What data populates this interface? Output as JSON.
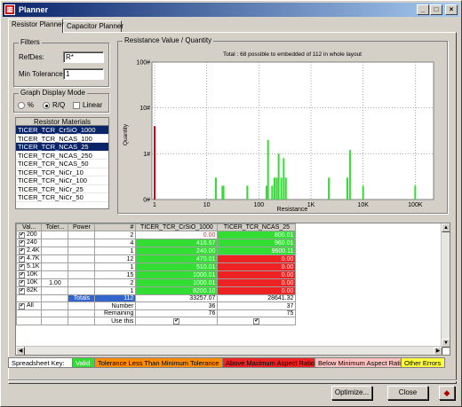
{
  "window": {
    "title": "Planner"
  },
  "title_buttons": {
    "minimize": "_",
    "maximize": "□",
    "close": "×"
  },
  "tabs": [
    {
      "label": "Resistor Planner",
      "active": true
    },
    {
      "label": "Capacitor Planner",
      "active": false
    }
  ],
  "filters": {
    "group_label": "Filters",
    "refdes_label": "RefDes:",
    "refdes_value": "R*",
    "min_tolerance_label": "Min Tolerance:",
    "min_tolerance_value": "1"
  },
  "graph_mode": {
    "group_label": "Graph Display Mode",
    "options": [
      {
        "label": "%",
        "selected": false
      },
      {
        "label": "R/Q",
        "selected": true
      }
    ],
    "linear_label": "Linear",
    "linear_checked": false
  },
  "materials": {
    "header": "Resistor Materials",
    "items": [
      {
        "label": "TICER_TCR_CrSiO_1000",
        "selected": true
      },
      {
        "label": "TICER_TCR_NCAS_100",
        "selected": false
      },
      {
        "label": "TICER_TCR_NCAS_25",
        "selected": true
      },
      {
        "label": "TICER_TCR_NCAS_250",
        "selected": false
      },
      {
        "label": "TICER_TCR_NCAS_50",
        "selected": false
      },
      {
        "label": "TICER_TCR_NiCr_10",
        "selected": false
      },
      {
        "label": "TICER_TCR_NiCr_100",
        "selected": false
      },
      {
        "label": "TICER_TCR_NiCr_25",
        "selected": false
      },
      {
        "label": "TICER_TCR_NiCr_50",
        "selected": false
      }
    ]
  },
  "chart_data": {
    "type": "bar",
    "frame_label": "Resistance Value / Quantity",
    "title": "Total : 68  possible to embedded of 112 in whole layout",
    "xlabel": "Resistance",
    "ylabel": "Quantity",
    "xscale": "log",
    "yscale": "log",
    "xlim": [
      1,
      200000
    ],
    "ylim": [
      1,
      1000
    ],
    "xticks": [
      {
        "v": 1,
        "t": "1"
      },
      {
        "v": 10,
        "t": "10"
      },
      {
        "v": 100,
        "t": "100"
      },
      {
        "v": 1000,
        "t": "1K"
      },
      {
        "v": 10000,
        "t": "10K"
      },
      {
        "v": 100000,
        "t": "100K"
      }
    ],
    "yticks": [
      {
        "v": 1,
        "t": "0#"
      },
      {
        "v": 10,
        "t": "1#"
      },
      {
        "v": 100,
        "t": "10#"
      },
      {
        "v": 1000,
        "t": "100#"
      }
    ],
    "bars": [
      {
        "x": 1.0,
        "y": 40,
        "color": "#e00000"
      },
      {
        "x": 15,
        "y": 3,
        "color": "#33dd33"
      },
      {
        "x": 20,
        "y": 2,
        "color": "#33dd33"
      },
      {
        "x": 21,
        "y": 2,
        "color": "#33dd33"
      },
      {
        "x": 60,
        "y": 2,
        "color": "#33dd33"
      },
      {
        "x": 140,
        "y": 2,
        "color": "#33dd33"
      },
      {
        "x": 150,
        "y": 20,
        "color": "#33dd33"
      },
      {
        "x": 180,
        "y": 2,
        "color": "#33dd33"
      },
      {
        "x": 200,
        "y": 3,
        "color": "#33dd33"
      },
      {
        "x": 220,
        "y": 3,
        "color": "#33dd33"
      },
      {
        "x": 240,
        "y": 10,
        "color": "#33dd33"
      },
      {
        "x": 270,
        "y": 3,
        "color": "#33dd33"
      },
      {
        "x": 300,
        "y": 8,
        "color": "#33dd33"
      },
      {
        "x": 330,
        "y": 3,
        "color": "#33dd33"
      },
      {
        "x": 2200,
        "y": 3,
        "color": "#33dd33"
      },
      {
        "x": 5000,
        "y": 3,
        "color": "#33dd33"
      },
      {
        "x": 5600,
        "y": 12,
        "color": "#33dd33"
      },
      {
        "x": 10000,
        "y": 2,
        "color": "#33dd33"
      },
      {
        "x": 100000,
        "y": 2,
        "color": "#33dd33"
      }
    ]
  },
  "spreadsheet": {
    "headers": [
      "Val...",
      "Toler...",
      "Power",
      "#",
      "TICER_TCR_CrSiO_1000",
      "TICER_TCR_NCAS_25"
    ],
    "rows": [
      {
        "val": "200",
        "tol": "",
        "power": "",
        "count": "2",
        "c1": "0.00",
        "c1bg": "#ffffff",
        "c2": "800.01",
        "c2bg": "#33dd33"
      },
      {
        "val": "240",
        "tol": "",
        "power": "",
        "count": "4",
        "c1": "416.67",
        "c1bg": "#33dd33",
        "c2": "960.01",
        "c2bg": "#33dd33"
      },
      {
        "val": "2.4K",
        "tol": "",
        "power": "",
        "count": "1",
        "c1": "240.00",
        "c1bg": "#33dd33",
        "c2": "9600.11",
        "c2bg": "#33dd33"
      },
      {
        "val": "4.7K",
        "tol": "",
        "power": "",
        "count": "12",
        "c1": "470.01",
        "c1bg": "#33dd33",
        "c2": "0.00",
        "c2bg": "#ee2222"
      },
      {
        "val": "5.1K",
        "tol": "",
        "power": "",
        "count": "1",
        "c1": "510.01",
        "c1bg": "#33dd33",
        "c2": "0.00",
        "c2bg": "#ee2222"
      },
      {
        "val": "10K",
        "tol": "",
        "power": "",
        "count": "15",
        "c1": "1000.01",
        "c1bg": "#33dd33",
        "c2": "0.00",
        "c2bg": "#ee2222"
      },
      {
        "val": "10K",
        "tol": "1.00",
        "power": "",
        "count": "2",
        "c1": "1000.01",
        "c1bg": "#33dd33",
        "c2": "0.00",
        "c2bg": "#ee2222"
      },
      {
        "val": "82K",
        "tol": "",
        "power": "",
        "count": "1",
        "c1": "8200.10",
        "c1bg": "#33dd33",
        "c2": "0.00",
        "c2bg": "#ee2222"
      }
    ],
    "totals_label": "Totals",
    "totals_count": "112",
    "totals_c1": "33257.07",
    "totals_c2": "28641.32",
    "all_label": "All",
    "number_label": "Number",
    "number_c1": "36",
    "number_c2": "37",
    "remaining_label": "Remaining",
    "remaining_c1": "76",
    "remaining_c2": "75",
    "usethis_label": "Use this"
  },
  "key": {
    "label": "Spreadsheet Key:",
    "items": [
      {
        "label": "Valid",
        "bg": "#33dd33",
        "color": "#ffffff"
      },
      {
        "label": "Tolerance Less Than Minimum Tolerance",
        "bg": "#ff8c00",
        "color": "#000000"
      },
      {
        "label": "Above Maximum Aspect Ratio",
        "bg": "#ee2222",
        "color": "#000000"
      },
      {
        "label": "Below Minimum Aspect Ratio",
        "bg": "#ffc0c0",
        "color": "#000000"
      },
      {
        "label": "Other Errors",
        "bg": "#ffff40",
        "color": "#000000"
      }
    ]
  },
  "buttons": {
    "optimize": "Optimize...",
    "close": "Close"
  }
}
